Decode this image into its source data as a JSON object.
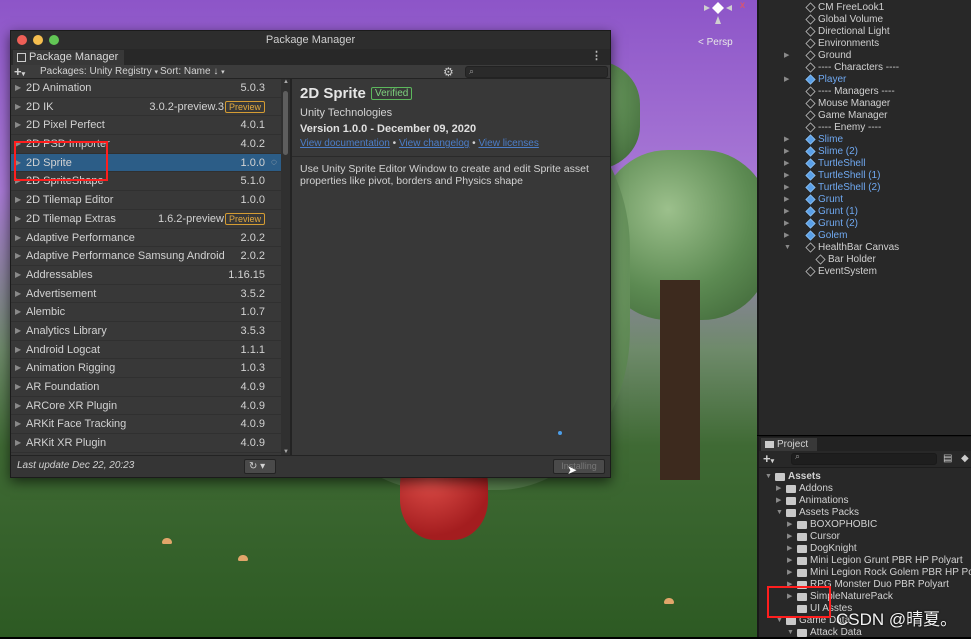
{
  "scene": {
    "persp_label": "< Persp",
    "gizmo_axis": "x"
  },
  "package_manager": {
    "window_title": "Package Manager",
    "tab_label": "Package Manager",
    "add_button": "+",
    "scope_dropdown": "Packages: Unity Registry",
    "sort_dropdown": "Sort: Name",
    "packages": [
      {
        "name": "2D Animation",
        "version": "5.0.3"
      },
      {
        "name": "2D IK",
        "version": "3.0.2-preview.3",
        "badge": "Preview"
      },
      {
        "name": "2D Pixel Perfect",
        "version": "4.0.1"
      },
      {
        "name": "2D PSD Importer",
        "version": "4.0.2"
      },
      {
        "name": "2D Sprite",
        "version": "1.0.0",
        "selected": true
      },
      {
        "name": "2D SpriteShape",
        "version": "5.1.0"
      },
      {
        "name": "2D Tilemap Editor",
        "version": "1.0.0"
      },
      {
        "name": "2D Tilemap Extras",
        "version": "1.6.2-preview",
        "badge": "Preview"
      },
      {
        "name": "Adaptive Performance",
        "version": "2.0.2"
      },
      {
        "name": "Adaptive Performance Samsung Android",
        "version": "2.0.2"
      },
      {
        "name": "Addressables",
        "version": "1.16.15"
      },
      {
        "name": "Advertisement",
        "version": "3.5.2"
      },
      {
        "name": "Alembic",
        "version": "1.0.7"
      },
      {
        "name": "Analytics Library",
        "version": "3.5.3"
      },
      {
        "name": "Android Logcat",
        "version": "1.1.1"
      },
      {
        "name": "Animation Rigging",
        "version": "1.0.3"
      },
      {
        "name": "AR Foundation",
        "version": "4.0.9"
      },
      {
        "name": "ARCore XR Plugin",
        "version": "4.0.9"
      },
      {
        "name": "ARKit Face Tracking",
        "version": "4.0.9"
      },
      {
        "name": "ARKit XR Plugin",
        "version": "4.0.9"
      }
    ],
    "detail": {
      "title": "2D Sprite",
      "verified_badge": "Verified",
      "author": "Unity Technologies",
      "version_line": "Version 1.0.0 - December 09, 2020",
      "link_docs": "View documentation",
      "link_changelog": "View changelog",
      "link_licenses": "View licenses",
      "description": "Use Unity Sprite Editor Window to create and edit Sprite asset properties like pivot, borders and Physics shape",
      "install_button": "Installing"
    },
    "footer": {
      "last_update": "Last update Dec 22, 20:23"
    }
  },
  "hierarchy": {
    "items": [
      {
        "label": "CM FreeLook1",
        "indent": 1,
        "blue": false
      },
      {
        "label": "Global Volume",
        "indent": 1,
        "blue": false
      },
      {
        "label": "Directional Light",
        "indent": 1,
        "blue": false
      },
      {
        "label": "Environments",
        "indent": 1,
        "blue": false
      },
      {
        "label": "Ground",
        "indent": 1,
        "blue": false,
        "caret": "right"
      },
      {
        "label": "---- Characters ----",
        "indent": 1,
        "blue": false
      },
      {
        "label": "Player",
        "indent": 1,
        "blue": true,
        "caret": "right"
      },
      {
        "label": "---- Managers ----",
        "indent": 1,
        "blue": false
      },
      {
        "label": "Mouse Manager",
        "indent": 1,
        "blue": false
      },
      {
        "label": "Game Manager",
        "indent": 1,
        "blue": false
      },
      {
        "label": "---- Enemy ----",
        "indent": 1,
        "blue": false
      },
      {
        "label": "Slime",
        "indent": 1,
        "blue": true,
        "caret": "right"
      },
      {
        "label": "Slime (2)",
        "indent": 1,
        "blue": true,
        "caret": "right"
      },
      {
        "label": "TurtleShell",
        "indent": 1,
        "blue": true,
        "caret": "right"
      },
      {
        "label": "TurtleShell (1)",
        "indent": 1,
        "blue": true,
        "caret": "right"
      },
      {
        "label": "TurtleShell (2)",
        "indent": 1,
        "blue": true,
        "caret": "right"
      },
      {
        "label": "Grunt",
        "indent": 1,
        "blue": true,
        "caret": "right"
      },
      {
        "label": "Grunt (1)",
        "indent": 1,
        "blue": true,
        "caret": "right"
      },
      {
        "label": "Grunt (2)",
        "indent": 1,
        "blue": true,
        "caret": "right"
      },
      {
        "label": "Golem",
        "indent": 1,
        "blue": true,
        "caret": "right"
      },
      {
        "label": "HealthBar Canvas",
        "indent": 1,
        "blue": false,
        "caret": "down"
      },
      {
        "label": "Bar Holder",
        "indent": 2,
        "blue": false
      },
      {
        "label": "EventSystem",
        "indent": 1,
        "blue": false
      }
    ]
  },
  "project": {
    "tab_label": "Project",
    "add_button": "+",
    "tree": [
      {
        "label": "Assets",
        "indent": 0,
        "caret": "down",
        "bold": true
      },
      {
        "label": "Addons",
        "indent": 1,
        "caret": "right"
      },
      {
        "label": "Animations",
        "indent": 1,
        "caret": "right"
      },
      {
        "label": "Assets Packs",
        "indent": 1,
        "caret": "down"
      },
      {
        "label": "BOXOPHOBIC",
        "indent": 2,
        "caret": "right"
      },
      {
        "label": "Cursor",
        "indent": 2,
        "caret": "right"
      },
      {
        "label": "DogKnight",
        "indent": 2,
        "caret": "right"
      },
      {
        "label": "Mini Legion Grunt PBR HP Polyart",
        "indent": 2,
        "caret": "right"
      },
      {
        "label": "Mini Legion Rock Golem PBR HP Polyart",
        "indent": 2,
        "caret": "right"
      },
      {
        "label": "RPG Monster Duo PBR Polyart",
        "indent": 2,
        "caret": "right"
      },
      {
        "label": "SimpleNaturePack",
        "indent": 2,
        "caret": "right"
      },
      {
        "label": "UI Asstes",
        "indent": 2,
        "caret": ""
      },
      {
        "label": "Game Data",
        "indent": 1,
        "caret": "down"
      },
      {
        "label": "Attack Data",
        "indent": 2,
        "caret": "down"
      }
    ]
  },
  "watermark": "CSDN @晴夏。",
  "colors": {
    "selection": "#2c5d87",
    "link": "#4c7ec9",
    "preview_badge": "#e2a93e",
    "verified_badge": "#5cb85c",
    "annotation": "#ff1e1e"
  }
}
